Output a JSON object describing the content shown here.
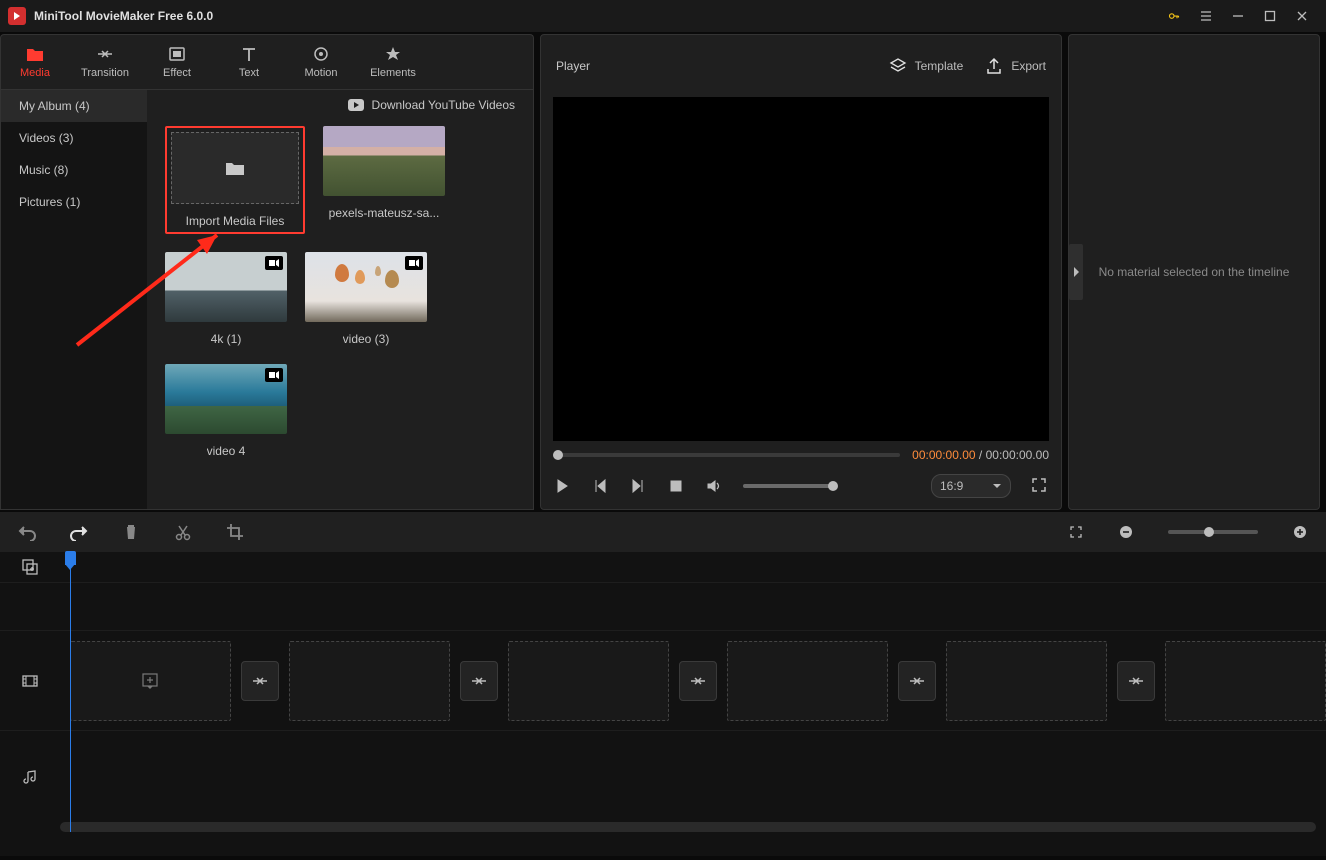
{
  "titlebar": {
    "title": "MiniTool MovieMaker Free 6.0.0"
  },
  "tabs": [
    {
      "id": "media",
      "label": "Media"
    },
    {
      "id": "transition",
      "label": "Transition"
    },
    {
      "id": "effect",
      "label": "Effect"
    },
    {
      "id": "text",
      "label": "Text"
    },
    {
      "id": "motion",
      "label": "Motion"
    },
    {
      "id": "elements",
      "label": "Elements"
    }
  ],
  "sidebar": {
    "items": [
      {
        "label": "My Album (4)"
      },
      {
        "label": "Videos (3)"
      },
      {
        "label": "Music (8)"
      },
      {
        "label": "Pictures (1)"
      }
    ]
  },
  "download_link": "Download YouTube Videos",
  "import_label": "Import Media Files",
  "media": [
    {
      "label": "pexels-mateusz-sa..."
    },
    {
      "label": "4k (1)"
    },
    {
      "label": "video (3)"
    },
    {
      "label": "video 4"
    }
  ],
  "player": {
    "title": "Player",
    "template_label": "Template",
    "export_label": "Export",
    "current_time": "00:00:00.00",
    "separator": " / ",
    "total_time": "00:00:00.00",
    "aspect": "16:9"
  },
  "inspector": {
    "empty_msg": "No material selected on the timeline"
  }
}
